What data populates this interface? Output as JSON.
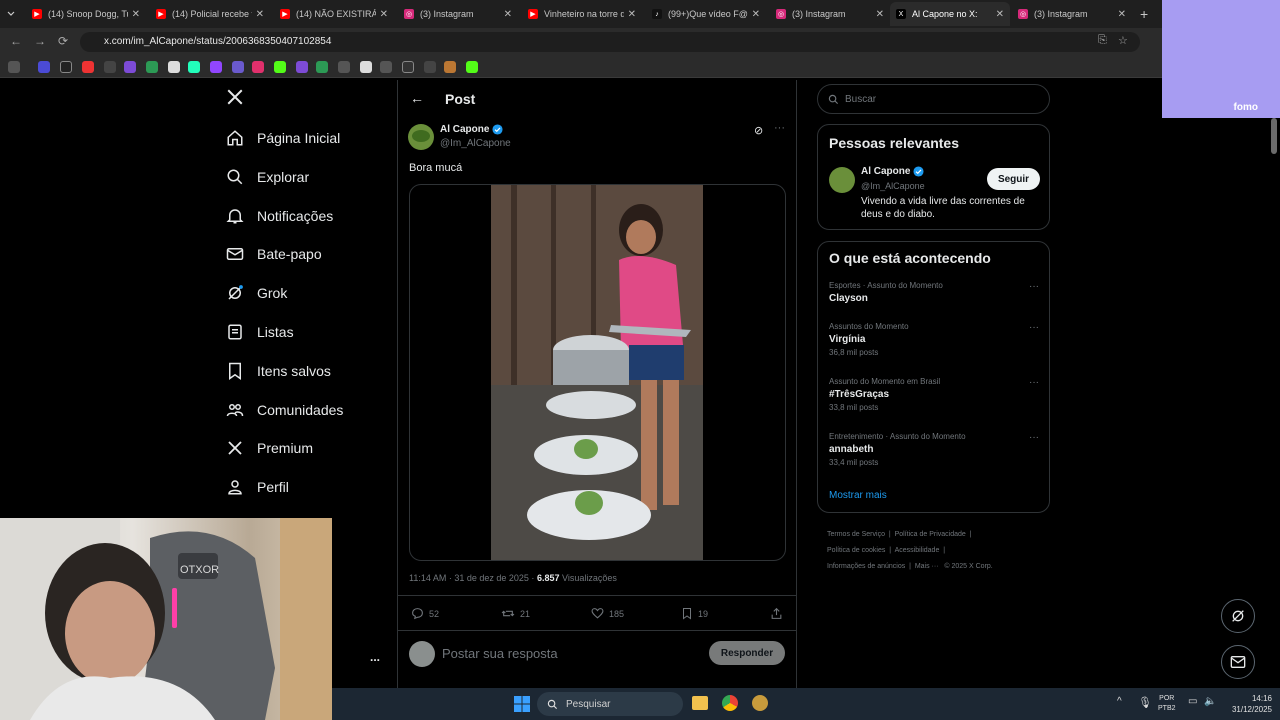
{
  "browser": {
    "tabs": [
      {
        "title": "(14) Snoop Dogg, Tu",
        "kind": "youtube"
      },
      {
        "title": "(14) Policial recebe vi",
        "kind": "youtube"
      },
      {
        "title": "(14) NÃO EXISTIRÁ M",
        "kind": "youtube"
      },
      {
        "title": "(3) Instagram",
        "kind": "instagram"
      },
      {
        "title": "Vinheteiro na torre d",
        "kind": "youtube"
      },
      {
        "title": "(99+)Que vídeo F@D",
        "kind": "tiktok"
      },
      {
        "title": "(3) Instagram",
        "kind": "instagram"
      },
      {
        "title": "Al Capone no X:",
        "kind": "x",
        "active": true
      },
      {
        "title": "(3) Instagram",
        "kind": "instagram"
      }
    ],
    "url": "x.com/im_AlCapone/status/2006368350407102854"
  },
  "overlay": {
    "brand": "fomo"
  },
  "nav": {
    "items": [
      {
        "label": "Página Inicial",
        "icon": "home-icon"
      },
      {
        "label": "Explorar",
        "icon": "search-icon"
      },
      {
        "label": "Notificações",
        "icon": "bell-icon"
      },
      {
        "label": "Bate-papo",
        "icon": "mail-icon"
      },
      {
        "label": "Grok",
        "icon": "grok-icon"
      },
      {
        "label": "Listas",
        "icon": "list-icon"
      },
      {
        "label": "Itens salvos",
        "icon": "bookmark-icon"
      },
      {
        "label": "Comunidades",
        "icon": "people-icon"
      },
      {
        "label": "Premium",
        "icon": "x-icon"
      },
      {
        "label": "Perfil",
        "icon": "user-icon"
      }
    ],
    "more": "..."
  },
  "post": {
    "header": "Post",
    "author": "Al Capone",
    "handle": "@Im_AlCapone",
    "text": "Bora mucá",
    "time": "11:14 AM · 31 de dez de 2025 ·",
    "views_count": "6.857",
    "views_label": "Visualizações",
    "replies": "52",
    "reposts": "21",
    "likes": "185",
    "bookmarks": "19",
    "reply_placeholder": "Postar sua resposta",
    "reply_button": "Responder"
  },
  "sidebar": {
    "search_placeholder": "Buscar",
    "relevant_title": "Pessoas relevantes",
    "person": {
      "name": "Al Capone",
      "handle": "@Im_AlCapone",
      "bio": "Vivendo a vida livre das correntes de deus e do diabo.",
      "follow": "Seguir"
    },
    "trends_title": "O que está acontecendo",
    "trends": [
      {
        "category": "Esportes · Assunto do Momento",
        "name": "Clayson",
        "count": ""
      },
      {
        "category": "Assuntos do Momento",
        "name": "Virgínia",
        "count": "36,8 mil posts"
      },
      {
        "category": "Assunto do Momento em Brasil",
        "name": "#TrêsGraças",
        "count": "33,8 mil posts"
      },
      {
        "category": "Entretenimento · Assunto do Momento",
        "name": "annabeth",
        "count": "33,4 mil posts"
      }
    ],
    "show_more": "Mostrar mais",
    "footer": {
      "l1": [
        "Termos de Serviço",
        "Política de Privacidade"
      ],
      "l2": [
        "Política de cookies",
        "Acessibilidade"
      ],
      "l3": [
        "Informações de anúncios",
        "Mais ···",
        "© 2025 X Corp."
      ]
    }
  },
  "taskbar": {
    "search": "Pesquisar",
    "lang1": "POR",
    "lang2": "PTB2",
    "time": "14:16",
    "date": "31/12/2025"
  },
  "webcam": {
    "chair_brand": "OTXOR"
  },
  "colors": {
    "accent": "#1d9bf0",
    "verified": "#1d9bf0",
    "bg": "#000000",
    "border": "#2f3336"
  }
}
